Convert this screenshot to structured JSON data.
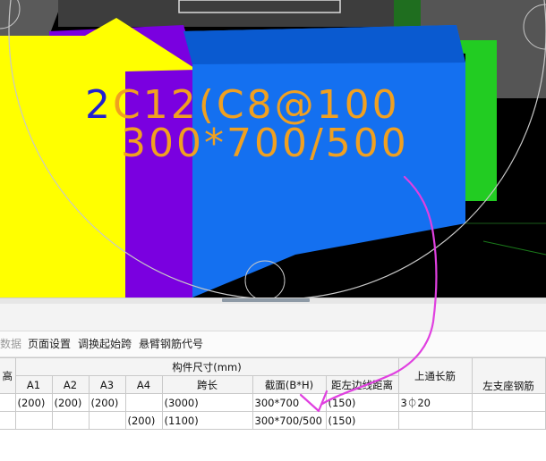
{
  "viewport": {
    "rebar_label_line1": "2C12(C8@100",
    "rebar_label_line2": "300*700/500",
    "colors": {
      "background": "#000000",
      "yellow_member": "#ffff00",
      "purple_member": "#7a00e0",
      "blue_beam": "#1470f0",
      "green_member": "#22cc22",
      "label_text": "#f0a020",
      "label_prefix": "#2020d0"
    }
  },
  "toolbar": {
    "data_item": "数据",
    "page_settings": "页面设置",
    "adjust_start_span": "调换起始跨",
    "cantilever_code": "悬臂钢筋代号"
  },
  "table": {
    "group_header": "构件尺寸(mm)",
    "columns": {
      "height": "高",
      "a1": "A1",
      "a2": "A2",
      "a3": "A3",
      "a4": "A4",
      "span_length": "跨长",
      "section": "截面(B*H)",
      "dist_left_edge": "距左边线距离",
      "top_through_bar": "上通长筋",
      "left_support_bar": "左支座钢筋"
    },
    "rows": [
      {
        "height": "",
        "a1": "(200)",
        "a2": "(200)",
        "a3": "(200)",
        "a4": "",
        "span_length": "(3000)",
        "section": "300*700",
        "dist_left_edge": "(150)",
        "top_through_bar": "3⏀20",
        "left_support_bar": ""
      },
      {
        "height": "",
        "a1": "",
        "a2": "",
        "a3": "",
        "a4": "(200)",
        "span_length": "(1100)",
        "section": "300*700/500",
        "dist_left_edge": "(150)",
        "top_through_bar": "",
        "left_support_bar": ""
      }
    ]
  }
}
